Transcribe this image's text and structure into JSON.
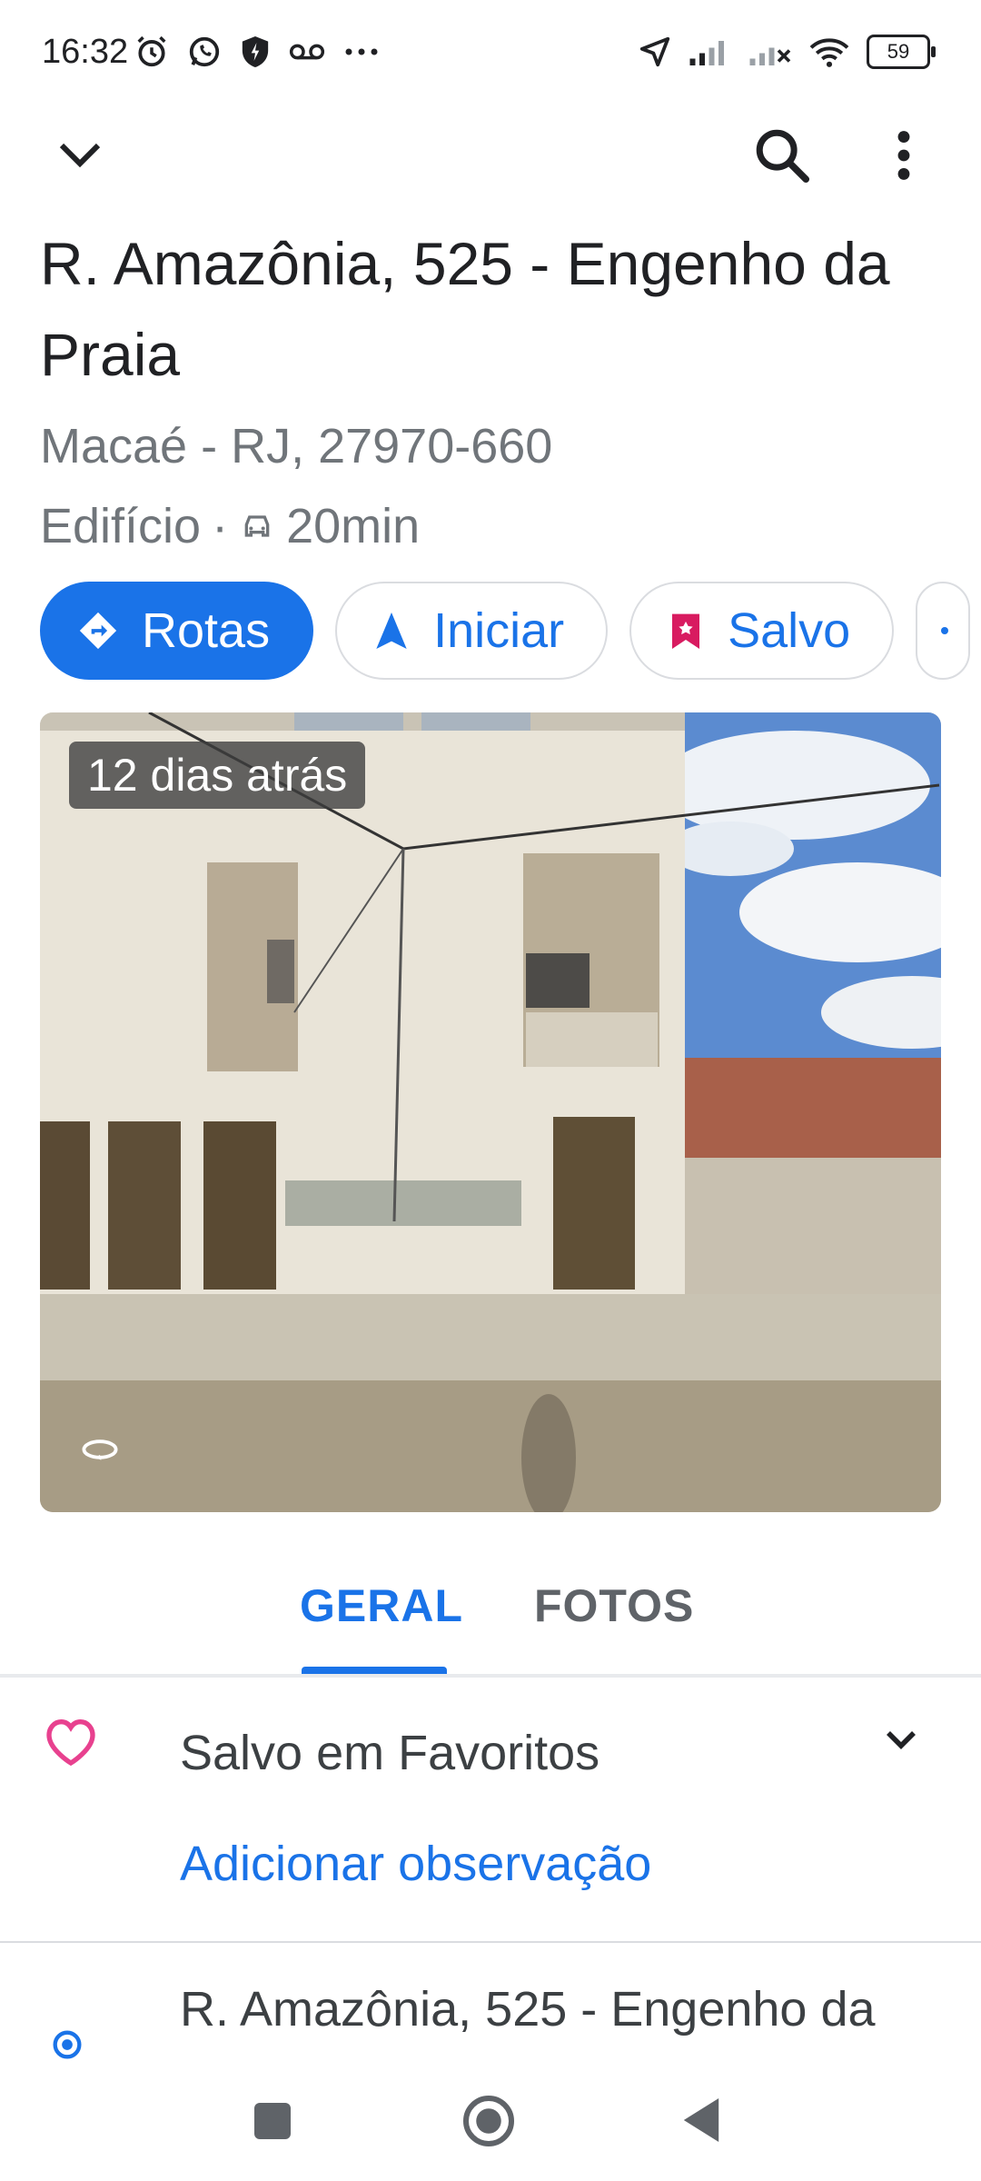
{
  "status_bar": {
    "time": "16:32",
    "battery": "59",
    "left_icons": [
      "alarm-icon",
      "whatsapp-icon",
      "shield-icon",
      "voicemail-icon",
      "more-dots-icon"
    ],
    "right_icons": [
      "location-arrow-icon",
      "signal-icon",
      "signal-off-icon",
      "wifi-icon",
      "battery-icon"
    ]
  },
  "header": {
    "title": "R. Amazônia, 525 - Engenho da Praia",
    "subtitle": "Macaé - RJ, 27970-660",
    "category": "Edifício",
    "separator": "·",
    "drive_time": "20min"
  },
  "actions": [
    {
      "label": "Rotas",
      "icon": "directions-icon"
    },
    {
      "label": "Iniciar",
      "icon": "navigation-icon"
    },
    {
      "label": "Salvo",
      "icon": "bookmark-icon"
    }
  ],
  "photo": {
    "badge": "12 dias atrás",
    "icon": "rotate-360-icon"
  },
  "tabs": [
    {
      "label": "GERAL",
      "selected": true
    },
    {
      "label": "FOTOS",
      "selected": false
    }
  ],
  "saved_section": {
    "label": "Salvo em Favoritos",
    "add_note": "Adicionar observação"
  },
  "address_row": {
    "text": "R. Amazônia, 525 - Engenho da"
  },
  "colors": {
    "accent": "#1a73e8",
    "heart": "#e8418f",
    "bookmark": "#d81b60"
  }
}
